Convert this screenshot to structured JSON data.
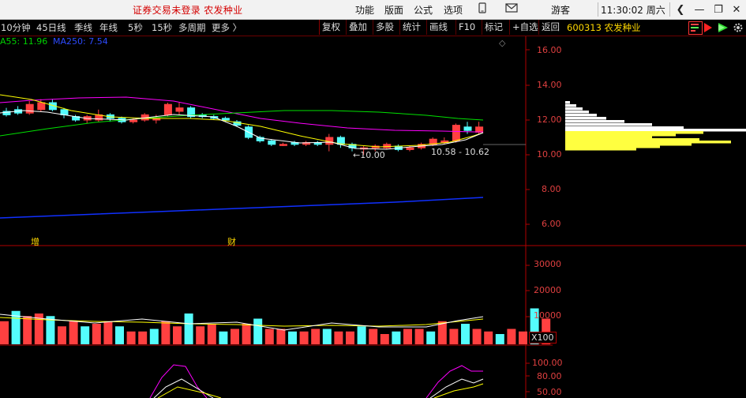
{
  "titlebar": {
    "title": "证券交易未登录  农发种业",
    "menus": [
      "功能",
      "版面",
      "公式",
      "选项"
    ],
    "user": "游客",
    "clock": "11:30:02 周六"
  },
  "toolbar": {
    "left_items": [
      "10分钟",
      "45日线",
      "季线",
      "年线",
      "5秒",
      "15秒",
      "多周期",
      "更多 〉"
    ],
    "buttons": [
      "复权",
      "叠加",
      "多股",
      "统计",
      "画线",
      "F10",
      "标记",
      "+自选",
      "返回"
    ],
    "code": "600313 农发种业"
  },
  "indicators": {
    "ma55": "A55: 11.96",
    "ma250": "MA250: 7.54"
  },
  "price_axis": [
    "16.00",
    "14.00",
    "12.00",
    "10.00",
    "8.00",
    "6.00"
  ],
  "volume_axis": [
    "30000",
    "20000",
    "10000"
  ],
  "volume_unit": "X100",
  "kdj_axis": [
    "100.00",
    "80.00",
    "50.00"
  ],
  "annotations": {
    "low": "10.00",
    "range": "10.58 - 10.62",
    "zeng": "增",
    "cai": "财"
  },
  "colors": {
    "up": "#ff4040",
    "down": "#54fcfc",
    "ma_white": "#ffffff",
    "ma_yellow": "#ffff00",
    "ma_magenta": "#ff00ff",
    "ma_green": "#00e000",
    "ma_blue": "#1030ff",
    "axis": "#b00000"
  }
}
